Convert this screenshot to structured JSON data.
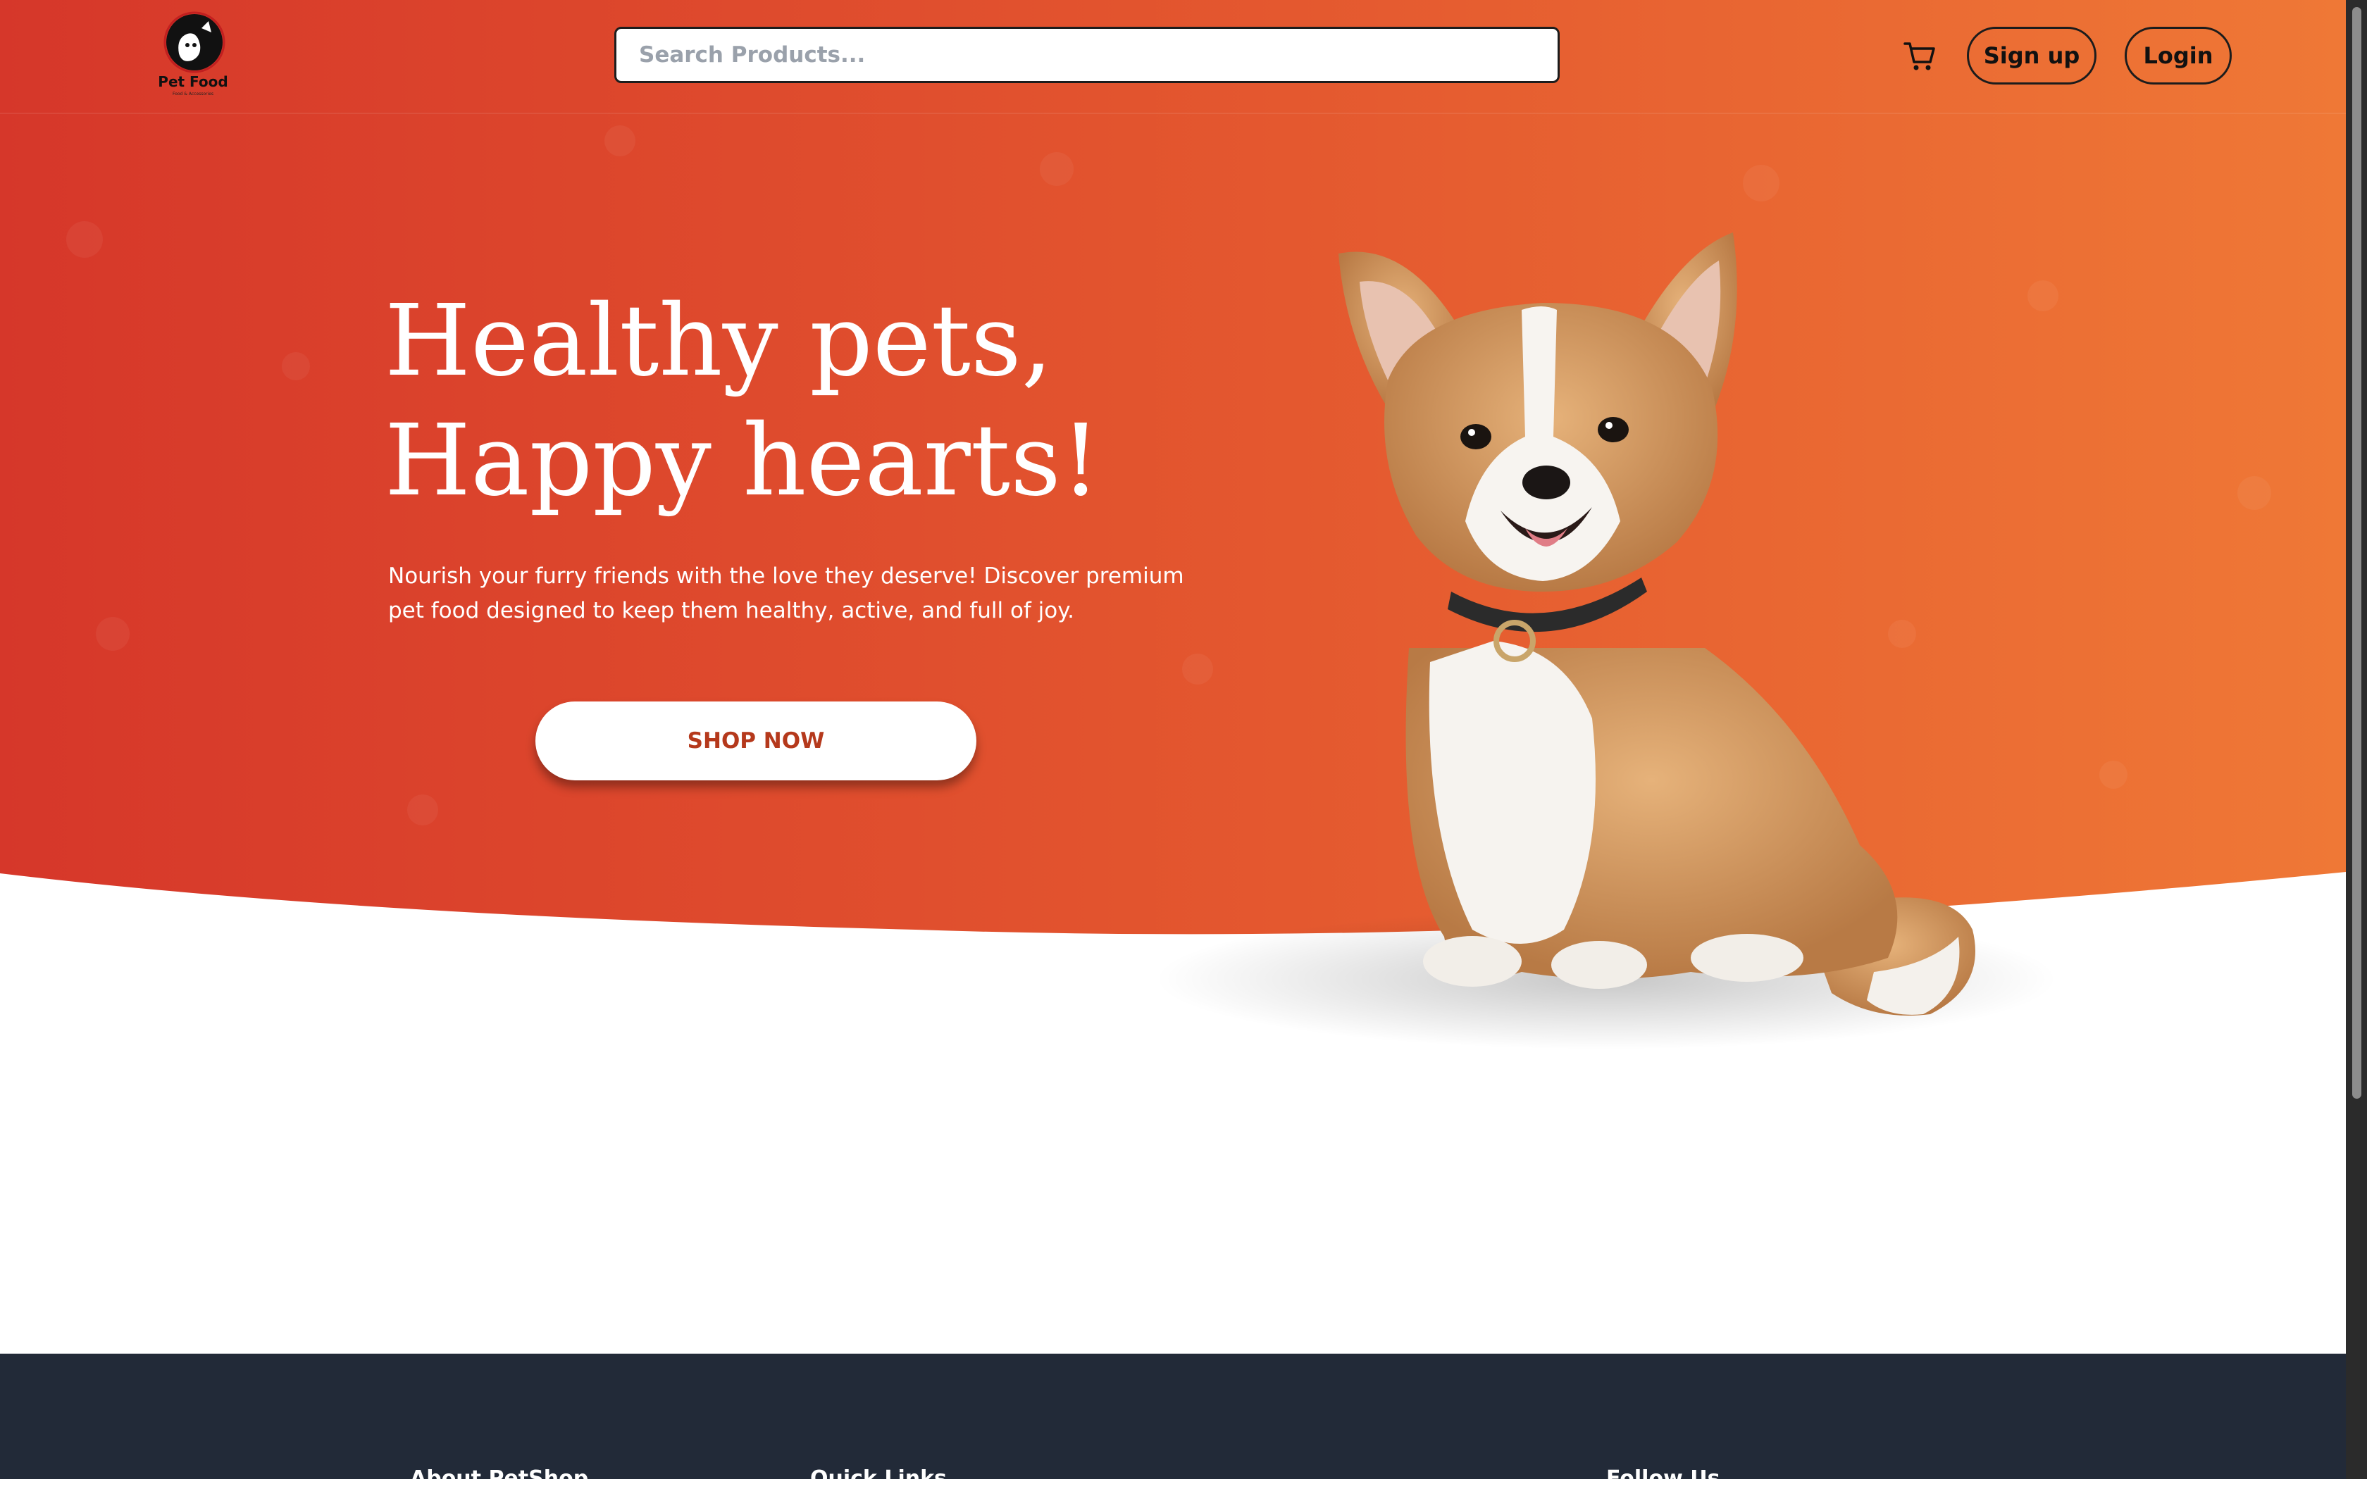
{
  "header": {
    "logo_brand": "Pet Food",
    "logo_tagline": "Food & Accessories",
    "search_placeholder": "Search Products...",
    "signup_label": "Sign up",
    "login_label": "Login"
  },
  "hero": {
    "headline_line1": "Healthy pets,",
    "headline_line2": "Happy hearts!",
    "description": "Nourish your furry friends with the love they deserve! Discover premium pet food designed to keep them healthy, active, and full of joy.",
    "cta_label": "SHOP NOW"
  },
  "footer": {
    "columns": [
      "About PetShop",
      "Quick Links",
      "Follow Us"
    ]
  },
  "colors": {
    "hero_gradient_start": "#d8392a",
    "hero_gradient_end": "#ee7535",
    "cta_text": "#b5391c",
    "footer_bg": "#222a38"
  },
  "icons": [
    "cart-icon",
    "logo-icon"
  ]
}
